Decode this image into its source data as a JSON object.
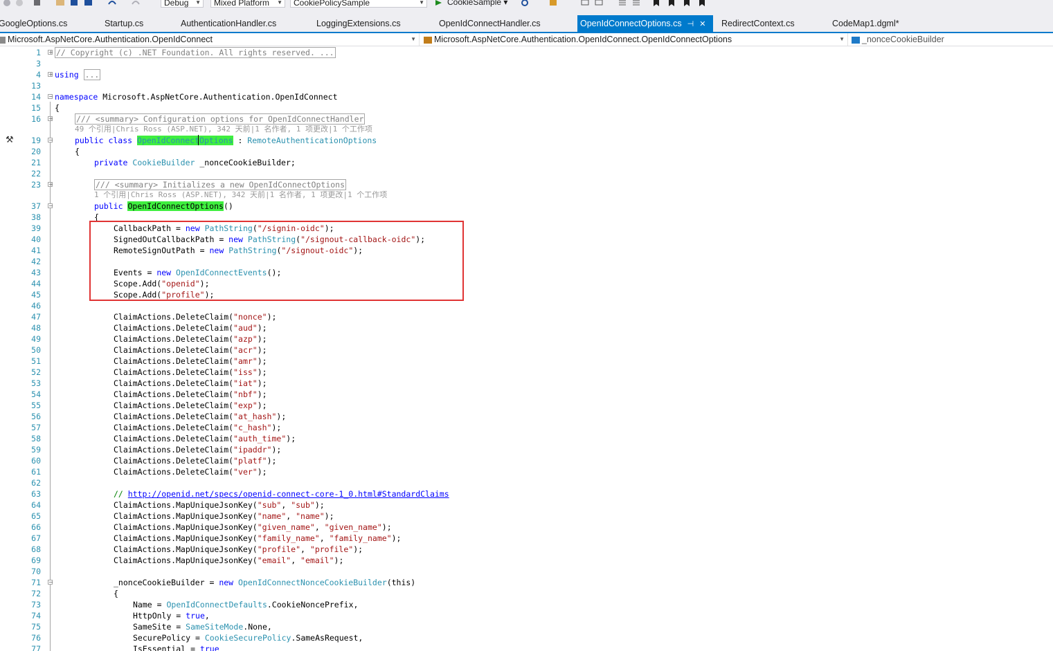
{
  "toolbar": {
    "config": "Debug",
    "platform": "Mixed Platform",
    "project": "CookiePolicySample",
    "run_target": "CookieSample"
  },
  "tabs": [
    {
      "label": "GoogleOptions.cs",
      "active": false
    },
    {
      "label": "Startup.cs",
      "active": false
    },
    {
      "label": "AuthenticationHandler.cs",
      "active": false
    },
    {
      "label": "LoggingExtensions.cs",
      "active": false
    },
    {
      "label": "OpenIdConnectHandler.cs",
      "active": false
    },
    {
      "label": "OpenIdConnectOptions.cs",
      "active": true
    },
    {
      "label": "RedirectContext.cs",
      "active": false
    },
    {
      "label": "CodeMap1.dgml*",
      "active": false
    }
  ],
  "nav": {
    "project_scope": "Microsoft.AspNetCore.Authentication.OpenIdConnect",
    "type_scope": "Microsoft.AspNetCore.Authentication.OpenIdConnect.OpenIdConnectOptions",
    "member_scope": "_nonceCookieBuilder"
  },
  "colors": {
    "accent": "#007acc",
    "highlight": "#3fef3f",
    "annotation_box": "#e03333",
    "keyword": "#0000ff",
    "type": "#2b91af",
    "string": "#a31515",
    "comment": "#008000"
  },
  "code": {
    "l1": "// Copyright (c) .NET Foundation. All rights reserved. ...",
    "l4_kw": "using",
    "l4_box": "...",
    "l14_kw": "namespace",
    "l14_ns": " Microsoft.AspNetCore.Authentication.OpenIdConnect",
    "l15": "{",
    "l16": "/// <summary> Configuration options for OpenIdConnectHandler",
    "lens1": "49 个引用|Chris Ross (ASP.NET), 342 天前|1 名作者, 1 项更改|1 个工作项",
    "l19_kw": "public class",
    "l19_name": "OpenIdConnectOptions",
    "l19_colon": " : ",
    "l19_base": "RemoteAuthenticationOptions",
    "l20": "{",
    "l21_kw": "private",
    "l21_type": "CookieBuilder",
    "l21_rest": " _nonceCookieBuilder;",
    "l23": "/// <summary> Initializes a new OpenIdConnectOptions",
    "lens2": "1 个引用|Chris Ross (ASP.NET), 342 天前|1 名作者, 1 项更改|1 个工作项",
    "l37_kw": "public",
    "l37_name": "OpenIdConnectOptions",
    "l37_rest": "()",
    "l38": "{",
    "l39_a": "CallbackPath = ",
    "l39_s": "\"/signin-oidc\"",
    "l40_a": "SignedOutCallbackPath = ",
    "l40_s": "\"/signout-callback-oidc\"",
    "l41_a": "RemoteSignOutPath = ",
    "l41_s": "\"/signout-oidc\"",
    "l43_a": "Events = ",
    "l43_t": "OpenIdConnectEvents",
    "l43_r": "();",
    "l44_s": "\"openid\"",
    "l45_s": "\"profile\"",
    "scope_add": "Scope.Add(",
    "close_paren": ");",
    "kw_new": "new",
    "ty_pathstring": "PathString",
    "open_paren": "(",
    "delete_prefix": "ClaimActions.DeleteClaim(",
    "claims": [
      "\"nonce\"",
      "\"aud\"",
      "\"azp\"",
      "\"acr\"",
      "\"amr\"",
      "\"iss\"",
      "\"iat\"",
      "\"nbf\"",
      "\"exp\"",
      "\"at_hash\"",
      "\"c_hash\"",
      "\"auth_time\"",
      "\"ipaddr\"",
      "\"platf\"",
      "\"ver\""
    ],
    "l63_cm": "// ",
    "l63_link": "http://openid.net/specs/openid-connect-core-1_0.html#StandardClaims",
    "map_prefix": "ClaimActions.MapUniqueJsonKey(",
    "maps": [
      [
        "\"sub\"",
        "\"sub\""
      ],
      [
        "\"name\"",
        "\"name\""
      ],
      [
        "\"given_name\"",
        "\"given_name\""
      ],
      [
        "\"family_name\"",
        "\"family_name\""
      ],
      [
        "\"profile\"",
        "\"profile\""
      ],
      [
        "\"email\"",
        "\"email\""
      ]
    ],
    "comma": ", ",
    "l71_a": "_nonceCookieBuilder = ",
    "l71_t": "OpenIdConnectNonceCookieBuilder",
    "l71_r": "(this)",
    "l72": "{",
    "l73_a": "Name = ",
    "l73_t": "OpenIdConnectDefaults",
    "l73_r": ".CookieNoncePrefix,",
    "l74_a": "HttpOnly = ",
    "l74_k": "true",
    "l74_r": ",",
    "l75_a": "SameSite = ",
    "l75_t": "SameSiteMode",
    "l75_r": ".None,",
    "l76_a": "SecurePolicy = ",
    "l76_t": "CookieSecurePolicy",
    "l76_r": ".SameAsRequest,",
    "l77_a": "IsEssential = ",
    "l77_k": "true"
  },
  "line_numbers": [
    "1",
    "3",
    "4",
    "13",
    "14",
    "15",
    "16",
    "19",
    "20",
    "21",
    "22",
    "23",
    "37",
    "38",
    "39",
    "40",
    "41",
    "42",
    "43",
    "44",
    "45",
    "46",
    "47",
    "48",
    "49",
    "50",
    "51",
    "52",
    "53",
    "54",
    "55",
    "56",
    "57",
    "58",
    "59",
    "60",
    "61",
    "62",
    "63",
    "64",
    "65",
    "66",
    "67",
    "68",
    "69",
    "70",
    "71",
    "72",
    "73",
    "74",
    "75",
    "76",
    "77"
  ]
}
